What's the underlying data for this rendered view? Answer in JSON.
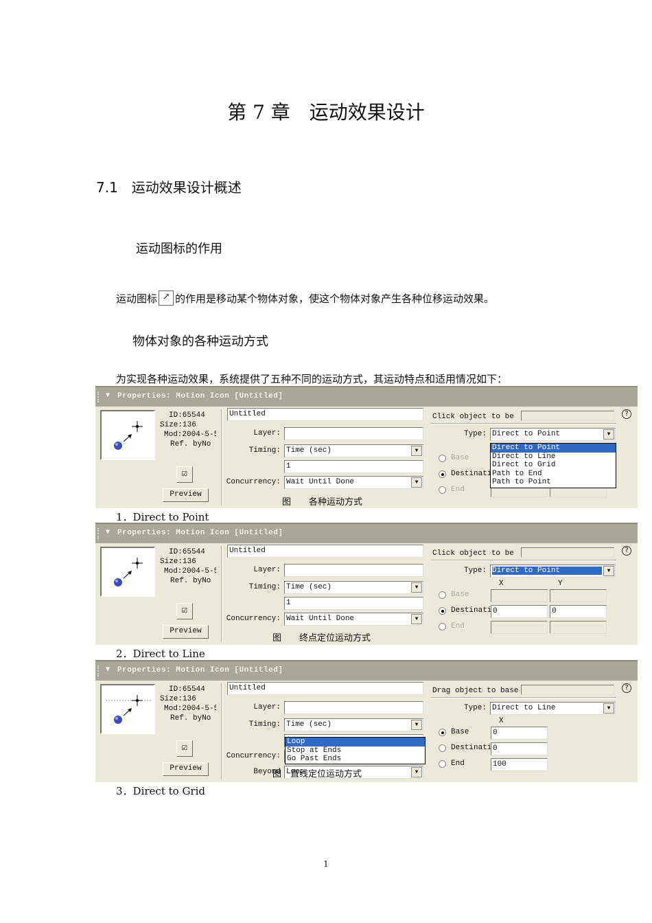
{
  "heading": "第 7 章　运动效果设计",
  "section": "7.1　运动效果设计概述",
  "sub1": "运动图标的作用",
  "para1_a": "运动图标",
  "para1_b": "的作用是移动某个物体对象，使这个物体对象产生各种位移运动效果。",
  "sub2": "物体对象的各种运动方式",
  "para2": "为实现各种运动效果，系统提供了五种不同的运动方式，其运动特点和适用情况如下：",
  "items": [
    "1．Direct to Point",
    "2．Direct to Line",
    "3．Direct to Grid"
  ],
  "page_number": "1",
  "panels": [
    {
      "title": "Properties: Motion Icon [Untitled]",
      "id": "ID:65544",
      "size": "Size:136",
      "mod": "Mod:2004-5-5",
      "ref": "Ref. byNo",
      "preview": "Preview",
      "name": "Untitled",
      "layer_label": "Layer:",
      "timing_label": "Timing:",
      "timing": "Time (sec)",
      "duration": "1",
      "conc_label": "Concurrency:",
      "conc": "Wait Until Done",
      "caption": "图　　各种运动方式",
      "hint": "Click object to be",
      "type_label": "Type:",
      "type": "Direct to Point",
      "type_hl": false,
      "x_hdr": "",
      "y_hdr": "",
      "radios": [
        {
          "label": "Base",
          "on": false,
          "en": false
        },
        {
          "label": "Destinati",
          "on": true,
          "en": true
        },
        {
          "label": "End",
          "on": false,
          "en": false
        }
      ],
      "fields": [
        [
          "",
          ""
        ],
        [
          "",
          ""
        ],
        [
          "",
          ""
        ]
      ],
      "type_list": [
        "Direct to Point",
        "Direct to Line",
        "Direct to Grid",
        "Path to End",
        "Path to Point"
      ]
    },
    {
      "title": "Properties: Motion Icon [Untitled]",
      "id": "ID:65544",
      "size": "Size:136",
      "mod": "Mod:2004-5-5",
      "ref": "Ref. byNo",
      "preview": "Preview",
      "name": "Untitled",
      "layer_label": "Layer:",
      "timing_label": "Timing:",
      "timing": "Time (sec)",
      "duration": "1",
      "conc_label": "Concurrency:",
      "conc": "Wait Until Done",
      "caption": "图　　终点定位运动方式",
      "hint": "Click object to be",
      "type_label": "Type:",
      "type": "Direct to Point",
      "type_hl": true,
      "x_hdr": "X",
      "y_hdr": "Y",
      "radios": [
        {
          "label": "Base",
          "on": false,
          "en": false
        },
        {
          "label": "Destinati",
          "on": true,
          "en": true
        },
        {
          "label": "End",
          "on": false,
          "en": false
        }
      ],
      "fields": [
        [
          "",
          ""
        ],
        [
          "0",
          "0"
        ],
        [
          "",
          ""
        ]
      ]
    },
    {
      "title": "Properties: Motion Icon [Untitled]",
      "id": "ID:65544",
      "size": "Size:136",
      "mod": "Mod:2004-5-5",
      "ref": "Ref. byNo",
      "preview": "Preview",
      "name": "Untitled",
      "layer_label": "Layer:",
      "timing_label": "Timing:",
      "timing": "Time (sec)",
      "duration": "1",
      "conc_label": "Concurrency:",
      "conc": "",
      "beyond_label": "Beyond",
      "beyond": "Loop",
      "caption": "图　直线定位运动方式",
      "hint": "Drag object to base",
      "type_label": "Type:",
      "type": "Direct to Line",
      "type_hl": false,
      "x_hdr": "X",
      "radios": [
        {
          "label": "Base",
          "on": true,
          "en": true
        },
        {
          "label": "Destinati",
          "on": false,
          "en": true
        },
        {
          "label": "End",
          "on": false,
          "en": true
        }
      ],
      "fields": [
        [
          "0"
        ],
        [
          "0"
        ],
        [
          "100"
        ]
      ],
      "beyond_list": [
        "Loop",
        "Stop at Ends",
        "Go Past Ends"
      ],
      "line_grid": true
    }
  ]
}
